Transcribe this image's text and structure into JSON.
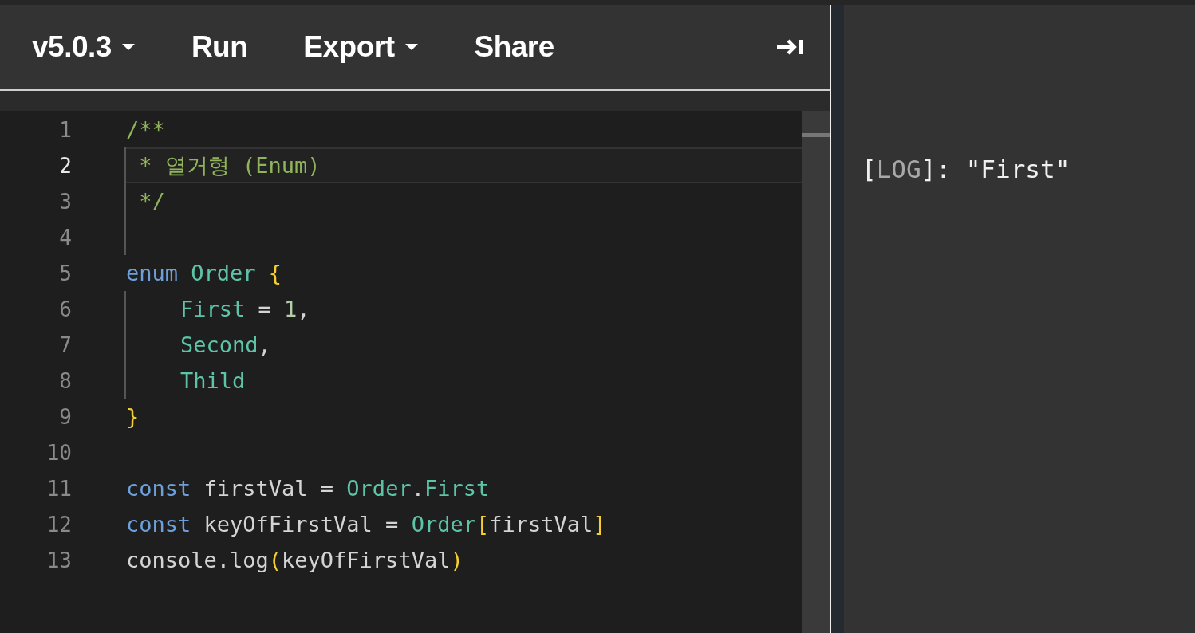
{
  "toolbar": {
    "items": [
      {
        "label": "v5.0.3",
        "dropdown": true
      },
      {
        "label": "Run",
        "dropdown": false
      },
      {
        "label": "Export",
        "dropdown": true
      },
      {
        "label": "Share",
        "dropdown": false
      }
    ]
  },
  "editor": {
    "lines": [
      {
        "number": "1",
        "selected": false,
        "guide": false,
        "tokens": [
          {
            "kind": "comment",
            "text": "/**"
          }
        ]
      },
      {
        "number": "2",
        "selected": true,
        "guide": true,
        "tokens": [
          {
            "kind": "comment",
            "text": " * 열거형 (Enum)"
          }
        ]
      },
      {
        "number": "3",
        "selected": false,
        "guide": true,
        "tokens": [
          {
            "kind": "comment",
            "text": " */"
          }
        ]
      },
      {
        "number": "4",
        "selected": false,
        "guide": true
      },
      {
        "number": "5",
        "selected": false,
        "guide": false,
        "tokens": [
          {
            "kind": "keyword",
            "text": "enum "
          },
          {
            "kind": "type",
            "text": "Order "
          },
          {
            "kind": "bracket",
            "text": "{"
          }
        ]
      },
      {
        "number": "6",
        "selected": false,
        "guide": true,
        "indented": true,
        "tokens": [
          {
            "kind": "type",
            "text": "First"
          },
          {
            "kind": "plain",
            "text": " = "
          },
          {
            "kind": "number",
            "text": "1"
          },
          {
            "kind": "plain",
            "text": ","
          }
        ]
      },
      {
        "number": "7",
        "selected": false,
        "guide": true,
        "indented": true,
        "tokens": [
          {
            "kind": "type",
            "text": "Second"
          },
          {
            "kind": "plain",
            "text": ","
          }
        ]
      },
      {
        "number": "8",
        "selected": false,
        "guide": true,
        "indented": true,
        "tokens": [
          {
            "kind": "type",
            "text": "Thild"
          }
        ]
      },
      {
        "number": "9",
        "selected": false,
        "guide": false,
        "tokens": [
          {
            "kind": "bracket",
            "text": "}"
          }
        ]
      },
      {
        "number": "10",
        "selected": false,
        "guide": false
      },
      {
        "number": "11",
        "selected": false,
        "guide": false,
        "tokens": [
          {
            "kind": "keyword",
            "text": "const"
          },
          {
            "kind": "plain",
            "text": " firstVal = "
          },
          {
            "kind": "type",
            "text": "Order"
          },
          {
            "kind": "plain",
            "text": "."
          },
          {
            "kind": "type",
            "text": "First"
          }
        ]
      },
      {
        "number": "12",
        "selected": false,
        "guide": false,
        "tokens": [
          {
            "kind": "keyword",
            "text": "const"
          },
          {
            "kind": "plain",
            "text": " keyOfFirstVal = "
          },
          {
            "kind": "type",
            "text": "Order"
          },
          {
            "kind": "bracket",
            "text": "["
          },
          {
            "kind": "plain",
            "text": "firstVal"
          },
          {
            "kind": "bracket",
            "text": "]"
          }
        ]
      },
      {
        "number": "13",
        "selected": false,
        "guide": false,
        "tokens": [
          {
            "kind": "plain",
            "text": "console.log"
          },
          {
            "kind": "bracket",
            "text": "("
          },
          {
            "kind": "plain",
            "text": "keyOfFirstVal"
          },
          {
            "kind": "bracket",
            "text": ")"
          }
        ]
      }
    ]
  },
  "output": {
    "lines": [
      {
        "parts": [
          {
            "kind": "plain",
            "text": "["
          },
          {
            "kind": "dim",
            "text": "LOG"
          },
          {
            "kind": "plain",
            "text": "]: \"First\""
          }
        ]
      }
    ]
  }
}
